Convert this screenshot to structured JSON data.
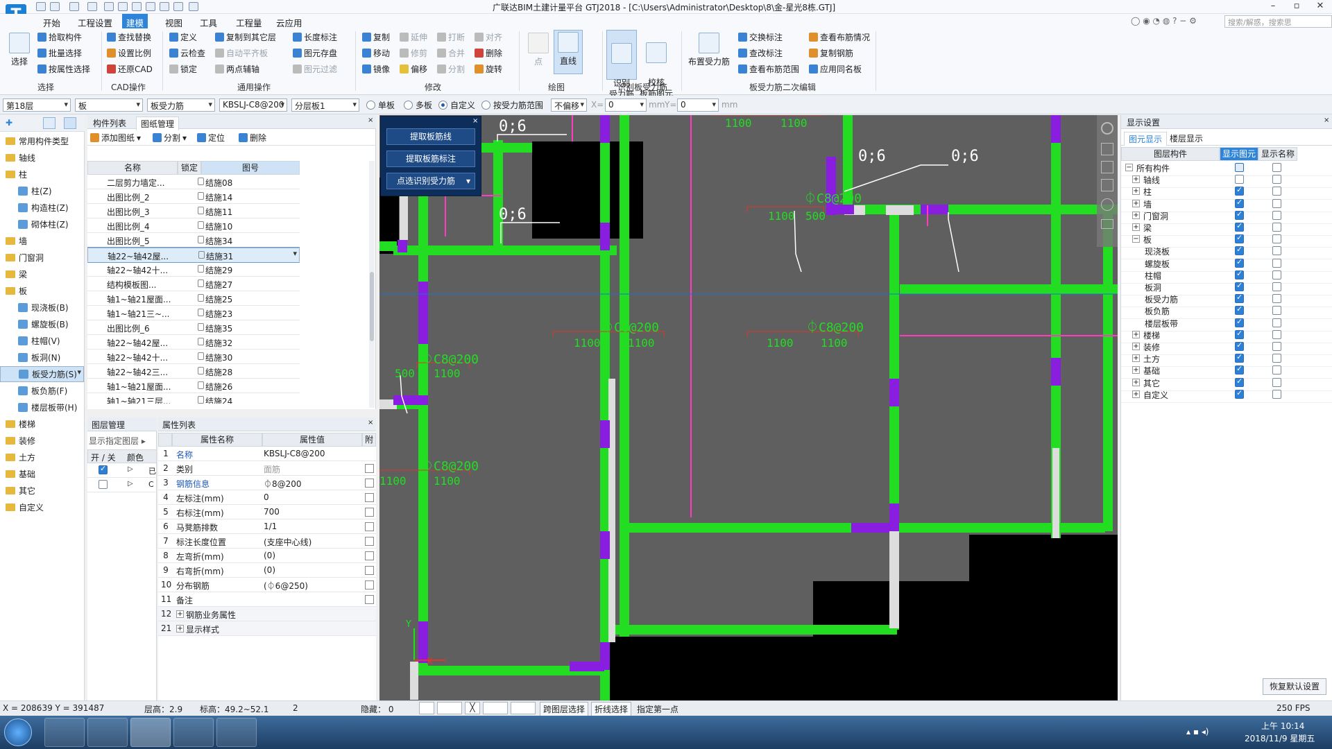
{
  "titlebar": {
    "app_title": "广联达BIM土建计量平台 GTJ2018 - [C:\\Users\\Administrator\\Desktop\\8\\金-星光8栋.GTJ]",
    "logo": "T"
  },
  "menubar": {
    "items": [
      "开始",
      "工程设置",
      "建模",
      "视图",
      "工具",
      "工程量",
      "云应用"
    ],
    "active": "建模",
    "search_placeholder": "搜索/解惑，搜索思"
  },
  "ribbon": {
    "select": {
      "big": "选择",
      "group": "选择",
      "items": [
        "拾取构件",
        "批量选择",
        "按属性选择"
      ]
    },
    "cad": {
      "group": "CAD操作",
      "items": [
        "查找替换",
        "设置比例",
        "还原CAD"
      ]
    },
    "common": {
      "group": "通用操作",
      "items": [
        "定义",
        "云检查",
        "锁定",
        "复制到其它层",
        "自动平齐板",
        "两点辅轴",
        "长度标注",
        "图元存盘",
        "图元过滤"
      ]
    },
    "modify": {
      "group": "修改",
      "items": [
        "复制",
        "移动",
        "镜像",
        "延伸",
        "修剪",
        "偏移",
        "打断",
        "合并",
        "分割",
        "对齐",
        "删除",
        "旋转"
      ]
    },
    "draw": {
      "group": "绘图",
      "point": "点",
      "line": "直线"
    },
    "recognize": {
      "group": "识别板受力筋",
      "btn1": "识别\n受力筋",
      "btn2": "校核\n板筋图元"
    },
    "secondary": {
      "group": "板受力筋二次编辑",
      "big": "布置受力筋",
      "items": [
        "交换标注",
        "查改标注",
        "查看布筋范围",
        "查看布筋情况",
        "复制钢筋",
        "应用同名板"
      ]
    }
  },
  "toolbar2": {
    "floor": "第18层",
    "type": "板",
    "subtype": "板受力筋",
    "spec": "KBSLJ-C8@200",
    "layer": "分层板1",
    "radios": [
      "单板",
      "多板",
      "自定义",
      "按受力筋范围"
    ],
    "radio_selected": "自定义",
    "offset_mode": "不偏移",
    "x_label": "X=",
    "x_value": "0",
    "y_label": "Y=",
    "y_value": "0",
    "unit": "mm"
  },
  "leftnav": {
    "items": [
      {
        "label": "常用构件类型",
        "kind": "f"
      },
      {
        "label": "轴线",
        "kind": "f"
      },
      {
        "label": "柱",
        "kind": "f"
      },
      {
        "label": "柱(Z)",
        "kind": "s"
      },
      {
        "label": "构造柱(Z)",
        "kind": "s"
      },
      {
        "label": "砌体柱(Z)",
        "kind": "s"
      },
      {
        "label": "墙",
        "kind": "f"
      },
      {
        "label": "门窗洞",
        "kind": "f"
      },
      {
        "label": "梁",
        "kind": "f"
      },
      {
        "label": "板",
        "kind": "f"
      },
      {
        "label": "现浇板(B)",
        "kind": "s"
      },
      {
        "label": "螺旋板(B)",
        "kind": "s"
      },
      {
        "label": "柱帽(V)",
        "kind": "s"
      },
      {
        "label": "板洞(N)",
        "kind": "s"
      },
      {
        "label": "板受力筋(S)",
        "kind": "s",
        "selected": true
      },
      {
        "label": "板负筋(F)",
        "kind": "s"
      },
      {
        "label": "楼层板带(H)",
        "kind": "s"
      },
      {
        "label": "楼梯",
        "kind": "f"
      },
      {
        "label": "装修",
        "kind": "f"
      },
      {
        "label": "土方",
        "kind": "f"
      },
      {
        "label": "基础",
        "kind": "f"
      },
      {
        "label": "其它",
        "kind": "f"
      },
      {
        "label": "自定义",
        "kind": "f"
      }
    ]
  },
  "drawlist": {
    "tabs": [
      "构件列表",
      "图纸管理"
    ],
    "active_tab": "图纸管理",
    "toolbar": [
      "添加图纸",
      "分割",
      "定位",
      "删除"
    ],
    "headers": [
      "名称",
      "锁定",
      "图号"
    ],
    "rows": [
      {
        "name": "二层剪力墙定...",
        "no": "结施08"
      },
      {
        "name": "出图比例_2",
        "no": "结施14"
      },
      {
        "name": "出图比例_3",
        "no": "结施11"
      },
      {
        "name": "出图比例_4",
        "no": "结施10"
      },
      {
        "name": "出图比例_5",
        "no": "结施34"
      },
      {
        "name": "轴22~轴42屋...",
        "no": "结施31",
        "selected": true
      },
      {
        "name": "轴22~轴42十...",
        "no": "结施29"
      },
      {
        "name": "结构模板图...",
        "no": "结施27"
      },
      {
        "name": "轴1~轴21屋面...",
        "no": "结施25"
      },
      {
        "name": "轴1~轴21三~...",
        "no": "结施23"
      },
      {
        "name": "出图比例_6",
        "no": "结施35"
      },
      {
        "name": "轴22~轴42屋...",
        "no": "结施32"
      },
      {
        "name": "轴22~轴42十...",
        "no": "结施30"
      },
      {
        "name": "轴22~轴42三...",
        "no": "结施28"
      },
      {
        "name": "轴1~轴21屋面...",
        "no": "结施26"
      },
      {
        "name": "轴1~轴21三层...",
        "no": "结施24"
      }
    ]
  },
  "layers": {
    "title": "图层管理",
    "subtitle": "显示指定图层",
    "headers": [
      "开 / 关",
      "颜色"
    ],
    "row_marks": [
      "已",
      "C"
    ]
  },
  "props": {
    "title": "属性列表",
    "headers": [
      "属性名称",
      "属性值",
      "附加"
    ],
    "rows": [
      {
        "n": "1",
        "k": "名称",
        "v": "KBSLJ-C8@200",
        "blue": true,
        "cb": false
      },
      {
        "n": "2",
        "k": "类别",
        "v": "面筋",
        "gray": true,
        "cb": true
      },
      {
        "n": "3",
        "k": "钢筋信息",
        "v": "⏀8@200",
        "blue": true,
        "cb": true
      },
      {
        "n": "4",
        "k": "左标注(mm)",
        "v": "0",
        "cb": true
      },
      {
        "n": "5",
        "k": "右标注(mm)",
        "v": "700",
        "cb": true
      },
      {
        "n": "6",
        "k": "马凳筋排数",
        "v": "1/1",
        "cb": true
      },
      {
        "n": "7",
        "k": "标注长度位置",
        "v": "(支座中心线)",
        "cb": true
      },
      {
        "n": "8",
        "k": "左弯折(mm)",
        "v": "(0)",
        "cb": true
      },
      {
        "n": "9",
        "k": "右弯折(mm)",
        "v": "(0)",
        "cb": true
      },
      {
        "n": "10",
        "k": "分布钢筋",
        "v": "(⏀6@250)",
        "cb": true
      },
      {
        "n": "11",
        "k": "备注",
        "v": "",
        "cb": true
      },
      {
        "n": "12",
        "k": "钢筋业务属性",
        "v": "",
        "expand": true,
        "cb": false
      },
      {
        "n": "21",
        "k": "显示样式",
        "v": "",
        "expand": true,
        "cb": false
      }
    ]
  },
  "popup": {
    "buttons": [
      "提取板筋线",
      "提取板筋标注",
      "点选识别受力筋"
    ]
  },
  "canvas_labels": {
    "ratio": "0;6",
    "rebar": "⏀C8@200",
    "dims": [
      "1100",
      "1100",
      "500"
    ],
    "axis_x": "X",
    "axis_y": "Y"
  },
  "right": {
    "title": "显示设置",
    "tabs": [
      "图元显示",
      "楼层显示"
    ],
    "active_tab": "图元显示",
    "headers": [
      "图层构件",
      "显示图元",
      "显示名称"
    ],
    "rows": [
      {
        "label": "所有构件",
        "level": 0,
        "pm": "−",
        "show": "partial",
        "name": false
      },
      {
        "label": "轴线",
        "level": 1,
        "pm": "+",
        "show": false,
        "name": false
      },
      {
        "label": "柱",
        "level": 1,
        "pm": "+",
        "show": true,
        "name": false
      },
      {
        "label": "墙",
        "level": 1,
        "pm": "+",
        "show": true,
        "name": false
      },
      {
        "label": "门窗洞",
        "level": 1,
        "pm": "+",
        "show": true,
        "name": false
      },
      {
        "label": "梁",
        "level": 1,
        "pm": "+",
        "show": true,
        "name": false
      },
      {
        "label": "板",
        "level": 1,
        "pm": "−",
        "show": true,
        "name": false
      },
      {
        "label": "现浇板",
        "level": 2,
        "show": true,
        "name": false
      },
      {
        "label": "螺旋板",
        "level": 2,
        "show": true,
        "name": false
      },
      {
        "label": "柱帽",
        "level": 2,
        "show": true,
        "name": false
      },
      {
        "label": "板洞",
        "level": 2,
        "show": true,
        "name": false
      },
      {
        "label": "板受力筋",
        "level": 2,
        "show": true,
        "name": false
      },
      {
        "label": "板负筋",
        "level": 2,
        "show": true,
        "name": false
      },
      {
        "label": "楼层板带",
        "level": 2,
        "show": true,
        "name": false
      },
      {
        "label": "楼梯",
        "level": 1,
        "pm": "+",
        "show": true,
        "name": false
      },
      {
        "label": "装修",
        "level": 1,
        "pm": "+",
        "show": true,
        "name": false
      },
      {
        "label": "土方",
        "level": 1,
        "pm": "+",
        "show": true,
        "name": false
      },
      {
        "label": "基础",
        "level": 1,
        "pm": "+",
        "show": true,
        "name": false
      },
      {
        "label": "其它",
        "level": 1,
        "pm": "+",
        "show": true,
        "name": false
      },
      {
        "label": "自定义",
        "level": 1,
        "pm": "+",
        "show": true,
        "name": false
      }
    ],
    "restore_button": "恢复默认设置"
  },
  "status": {
    "coords": "X = 208639 Y = 391487",
    "floor_height": "层高：2.9",
    "elevation": "标高：49.2~52.1",
    "count": "2",
    "hidden": "隐藏： 0",
    "btn_cross_layer": "跨图层选择",
    "btn_polyline": "折线选择",
    "hint": "指定第一点",
    "fps": "250 FPS"
  },
  "taskbar": {
    "time": "上午 10:14",
    "date": "2018/11/9 星期五"
  },
  "colors": {
    "accent": "#2d84d8",
    "canvas_bg": "#5f5f5f",
    "beam_green": "#22dd22",
    "column_purple": "#8a1ee0",
    "rebar_pink": "#ff3cbf",
    "dim_red": "#e0342c"
  }
}
